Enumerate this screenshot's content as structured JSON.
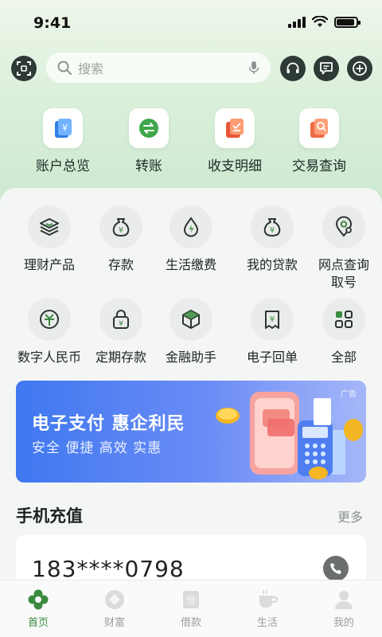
{
  "status": {
    "time": "9:41"
  },
  "search": {
    "placeholder": "搜索"
  },
  "quick_actions": [
    {
      "label": "账户总览",
      "icon": "account-overview-icon"
    },
    {
      "label": "转账",
      "icon": "transfer-icon"
    },
    {
      "label": "收支明细",
      "icon": "statement-icon"
    },
    {
      "label": "交易查询",
      "icon": "transaction-query-icon"
    }
  ],
  "services": [
    {
      "label": "理财产品",
      "icon": "wealth-products-icon"
    },
    {
      "label": "存款",
      "icon": "deposit-icon"
    },
    {
      "label": "生活缴费",
      "icon": "utility-payment-icon"
    },
    {
      "label": "我的贷款",
      "icon": "loan-icon"
    },
    {
      "label": "网点查询取号",
      "line1": "网点查询",
      "line2": "取号",
      "icon": "branch-search-icon"
    },
    {
      "label": "数字人民币",
      "icon": "digital-rmb-icon"
    },
    {
      "label": "定期存款",
      "icon": "fixed-deposit-icon"
    },
    {
      "label": "金融助手",
      "icon": "finance-assistant-icon"
    },
    {
      "label": "电子回单",
      "icon": "e-receipt-icon"
    },
    {
      "label": "全部",
      "icon": "all-services-icon"
    }
  ],
  "banner": {
    "ad_tag": "广告",
    "title": "电子支付 惠企利民",
    "subtitle": "安全 便捷 高效 实惠"
  },
  "recharge": {
    "title": "手机充值",
    "more": "更多",
    "phone": "183****0798"
  },
  "tabs": [
    {
      "label": "首页",
      "active": true
    },
    {
      "label": "财富",
      "active": false
    },
    {
      "label": "借款",
      "active": false
    },
    {
      "label": "生活",
      "active": false
    },
    {
      "label": "我的",
      "active": false
    }
  ],
  "colors": {
    "accent": "#3a8a3f",
    "banner": "#3f78f0",
    "header_green": "#c9e6cf"
  }
}
